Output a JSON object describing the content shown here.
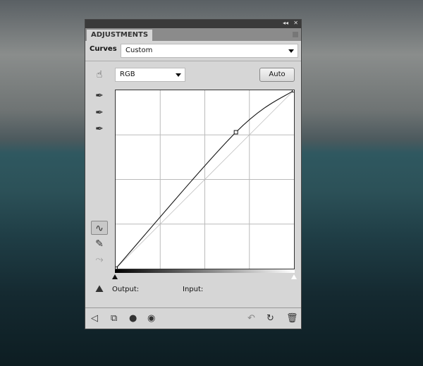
{
  "panel": {
    "tab": "ADJUSTMENTS",
    "collapse_icon": "double-chevron-left-icon",
    "close_icon": "close-icon",
    "adjustment_label": "Curves",
    "preset_value": "Custom",
    "channel_value": "RGB",
    "auto_label": "Auto",
    "output_label": "Output:",
    "input_label": "Input:"
  },
  "chart_data": {
    "type": "line",
    "xlim": [
      0,
      255
    ],
    "ylim": [
      0,
      255
    ],
    "grid": "4x4",
    "points": [
      {
        "input": 0,
        "output": 0
      },
      {
        "input": 172,
        "output": 195
      },
      {
        "input": 255,
        "output": 255
      }
    ]
  },
  "colors": {
    "panel": "#d6d6d6",
    "titlebar": "#3a3a3a"
  }
}
